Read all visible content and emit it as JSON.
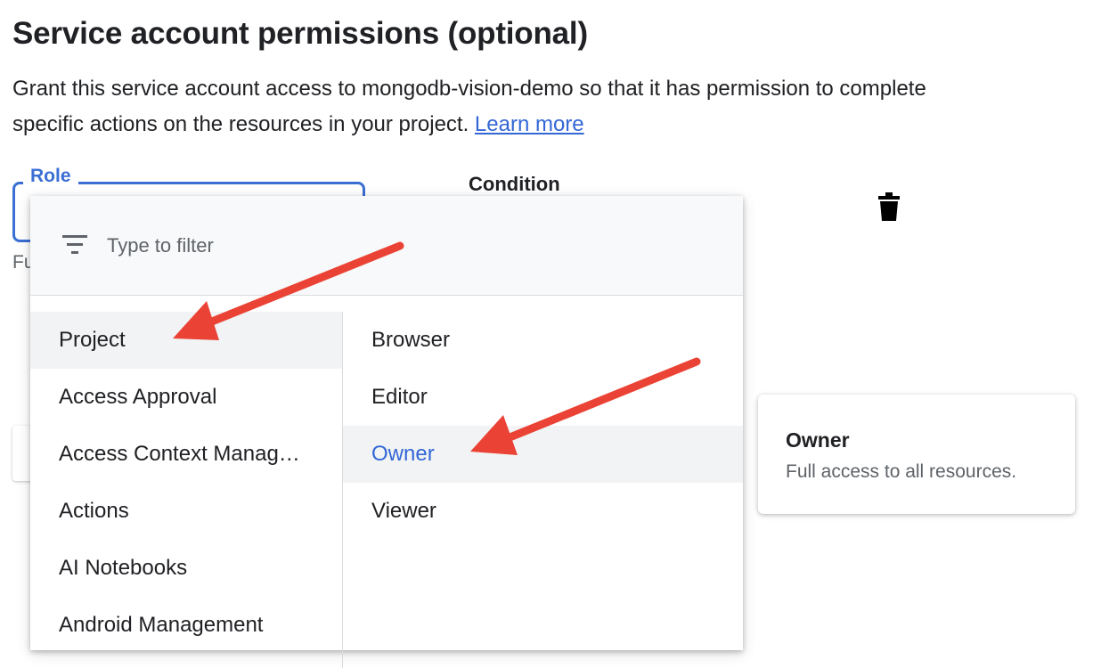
{
  "header": {
    "title": "Service account permissions (optional)",
    "description": "Grant this service account access to mongodb-vision-demo so that it has permission to complete specific actions on the resources in your project.",
    "learn_more": "Learn more"
  },
  "role_field": {
    "label": "Role",
    "helper_text": "Full access to all resources."
  },
  "condition": {
    "label": "Condition"
  },
  "dropdown": {
    "filter_placeholder": "Type to filter",
    "categories": [
      {
        "label": "Project",
        "selected": true
      },
      {
        "label": "Access Approval"
      },
      {
        "label": "Access Context Manag…"
      },
      {
        "label": "Actions"
      },
      {
        "label": "AI Notebooks"
      },
      {
        "label": "Android Management"
      }
    ],
    "roles": [
      {
        "label": "Browser"
      },
      {
        "label": "Editor"
      },
      {
        "label": "Owner",
        "active": true
      },
      {
        "label": "Viewer"
      }
    ]
  },
  "tooltip": {
    "title": "Owner",
    "description": "Full access to all resources."
  },
  "icons": {
    "filter": "filter-list-icon",
    "delete": "trash-icon"
  },
  "colors": {
    "accent": "#3b6fd4",
    "link": "#3367d6",
    "annotation_arrow": "#ea4335",
    "selected_bg": "#f1f3f4"
  }
}
